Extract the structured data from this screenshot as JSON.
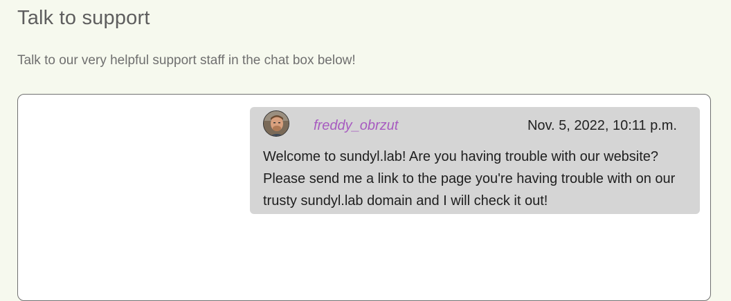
{
  "header": {
    "title": "Talk to support",
    "subtitle": "Talk to our very helpful support staff in the chat box below!"
  },
  "chat": {
    "messages": [
      {
        "author": "freddy_obrzut",
        "timestamp": "Nov. 5, 2022, 10:11 p.m.",
        "text": "Welcome to sundyl.lab! Are you having trouble with our website? Please send me a link to the page you're having trouble with on our trusty sundyl.lab domain and I will check it out!",
        "avatar_icon": "user-avatar-photo"
      }
    ]
  },
  "colors": {
    "page_background": "#f6f9ee",
    "chat_background": "#ffffff",
    "message_background": "#d5d5d5",
    "author_color": "#a75bc0",
    "title_color": "#5e5e5e"
  }
}
